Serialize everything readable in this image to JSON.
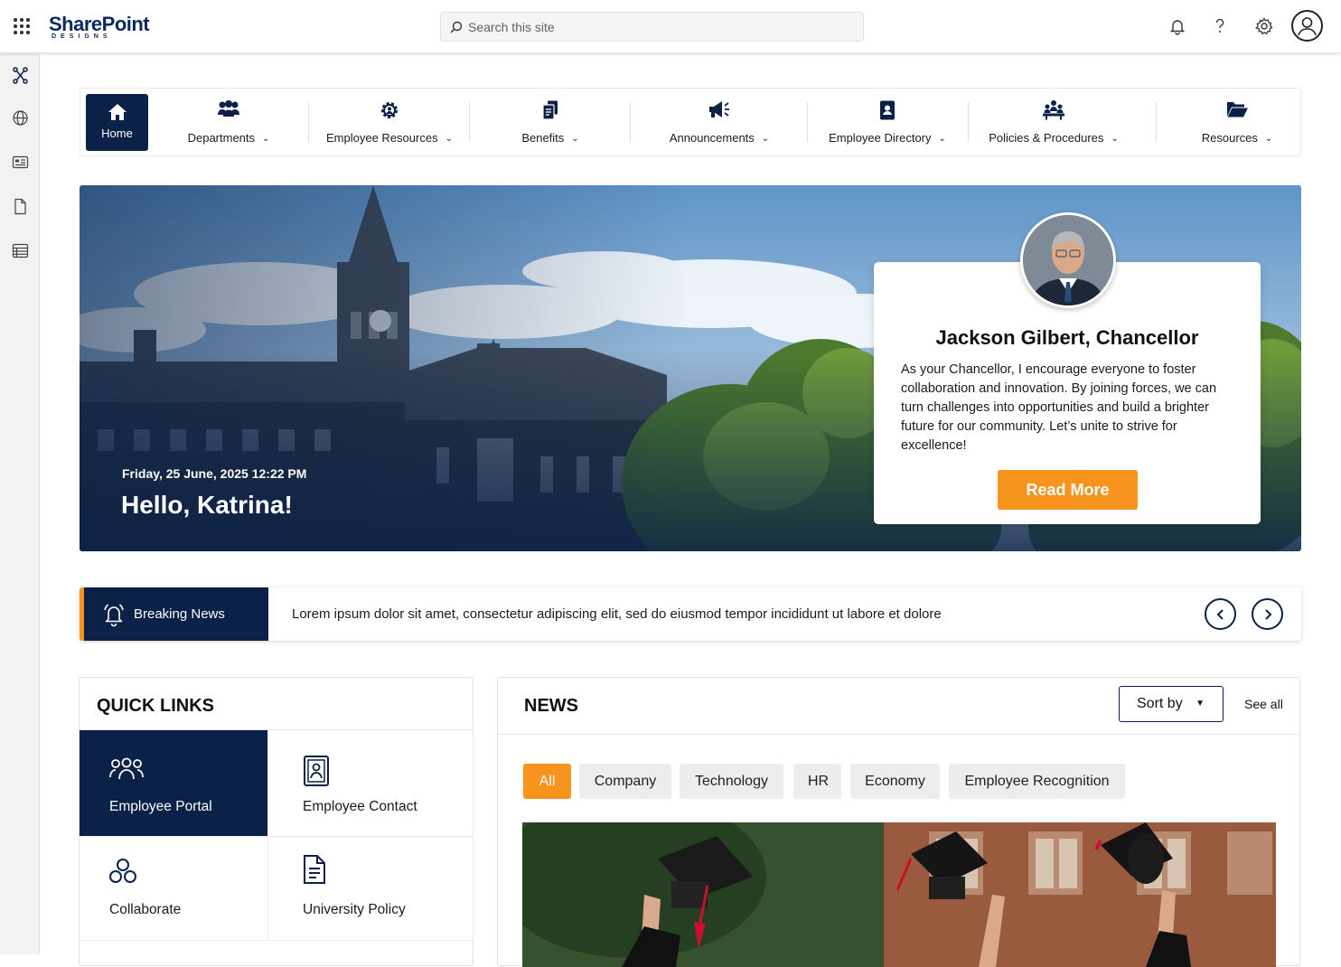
{
  "header": {
    "logo_text": "SharePoint",
    "logo_subtext": "DESIGNS",
    "search_placeholder": "Search this site"
  },
  "nav": {
    "home_label": "Home",
    "items": [
      {
        "label": "Departments",
        "icon": "people-group-icon"
      },
      {
        "label": "Employee Resources",
        "icon": "gear-person-icon"
      },
      {
        "label": "Benefits",
        "icon": "documents-icon"
      },
      {
        "label": "Announcements",
        "icon": "megaphone-icon"
      },
      {
        "label": "Employee Directory",
        "icon": "contact-book-icon"
      },
      {
        "label": "Policies & Procedures",
        "icon": "meeting-icon"
      },
      {
        "label": "Resources",
        "icon": "folder-open-icon"
      }
    ]
  },
  "hero": {
    "date": "Friday, 25 June, 2025  12:22 PM",
    "greeting": "Hello, Katrina!",
    "card": {
      "name": "Jackson Gilbert, Chancellor",
      "message": "As your Chancellor, I encourage everyone to foster collaboration and innovation. By joining forces, we can turn challenges into opportunities and build a brighter future for our community. Let’s unite to strive for excellence!",
      "button": "Read More"
    }
  },
  "breaking": {
    "label": "Breaking News",
    "text": "Lorem ipsum dolor sit amet, consectetur adipiscing elit, sed do eiusmod tempor incididunt ut labore et dolore"
  },
  "quick_links": {
    "title": "QUICK LINKS",
    "items": [
      {
        "label": "Employee Portal",
        "icon": "people-icon",
        "active": true
      },
      {
        "label": "Employee Contact",
        "icon": "contact-card-icon",
        "active": false
      },
      {
        "label": "Collaborate",
        "icon": "collaborate-icon",
        "active": false
      },
      {
        "label": "University Policy",
        "icon": "document-icon",
        "active": false
      }
    ]
  },
  "news": {
    "title": "NEWS",
    "sort_label": "Sort by",
    "see_all": "See all",
    "filters": [
      "All",
      "Company",
      "Technology",
      "HR",
      "Economy",
      "Employee Recognition"
    ],
    "active_filter": "All"
  },
  "colors": {
    "navy": "#0b2147",
    "accent": "#f7941d"
  }
}
